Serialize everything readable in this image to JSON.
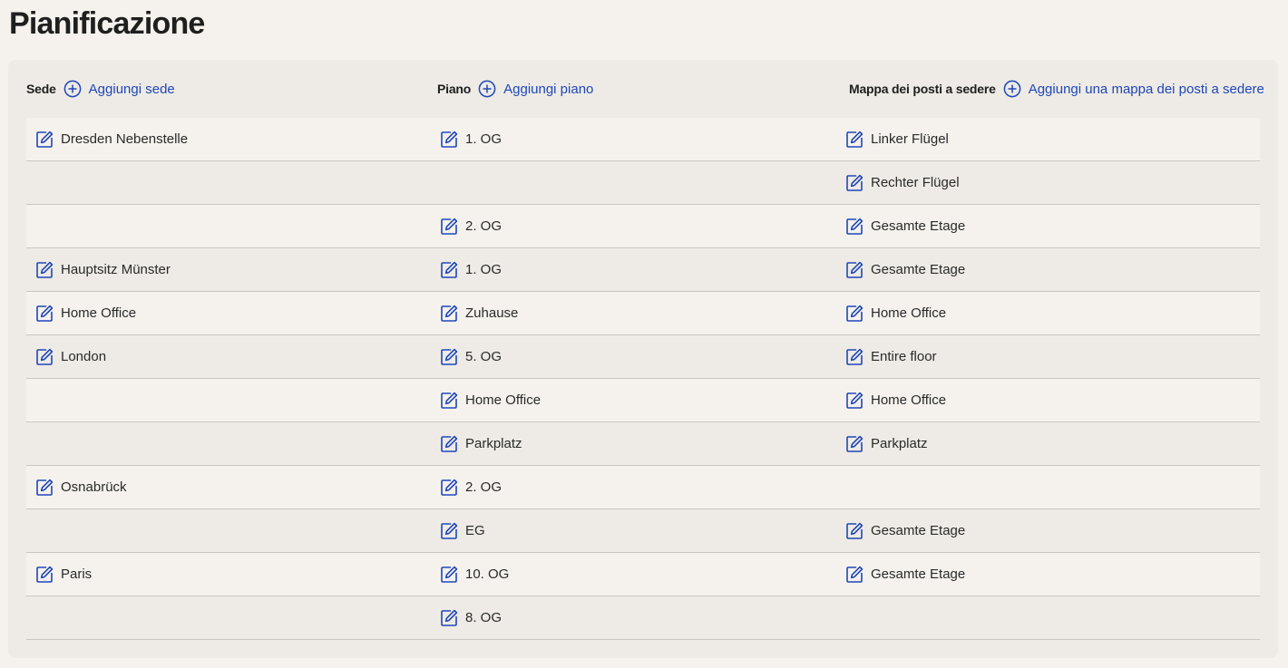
{
  "page": {
    "title": "Pianificazione"
  },
  "colors": {
    "accent": "#1f47b8",
    "background": "#f5f2ee",
    "panel": "#eeebe6",
    "row_border": "#c9c6c1"
  },
  "icons": {
    "add": "plus-circle-icon",
    "edit": "edit-icon"
  },
  "columns": [
    {
      "label": "Sede",
      "add_label": "Aggiungi sede"
    },
    {
      "label": "Piano",
      "add_label": "Aggiungi piano"
    },
    {
      "label": "Mappa dei posti a sedere",
      "add_label": "Aggiungi una mappa dei posti a sedere"
    }
  ],
  "rows": [
    {
      "sede": "Dresden Nebenstelle",
      "piano": "1. OG",
      "mappa": "Linker Flügel"
    },
    {
      "sede": "",
      "piano": "",
      "mappa": "Rechter Flügel"
    },
    {
      "sede": "",
      "piano": "2. OG",
      "mappa": "Gesamte Etage"
    },
    {
      "sede": "Hauptsitz Münster",
      "piano": "1. OG",
      "mappa": "Gesamte Etage"
    },
    {
      "sede": "Home Office",
      "piano": "Zuhause",
      "mappa": "Home Office"
    },
    {
      "sede": "London",
      "piano": "5. OG",
      "mappa": "Entire floor"
    },
    {
      "sede": "",
      "piano": "Home Office",
      "mappa": "Home Office"
    },
    {
      "sede": "",
      "piano": "Parkplatz",
      "mappa": "Parkplatz"
    },
    {
      "sede": "Osnabrück",
      "piano": "2. OG",
      "mappa": ""
    },
    {
      "sede": "",
      "piano": "EG",
      "mappa": "Gesamte Etage"
    },
    {
      "sede": "Paris",
      "piano": "10. OG",
      "mappa": "Gesamte Etage"
    },
    {
      "sede": "",
      "piano": "8. OG",
      "mappa": ""
    }
  ]
}
